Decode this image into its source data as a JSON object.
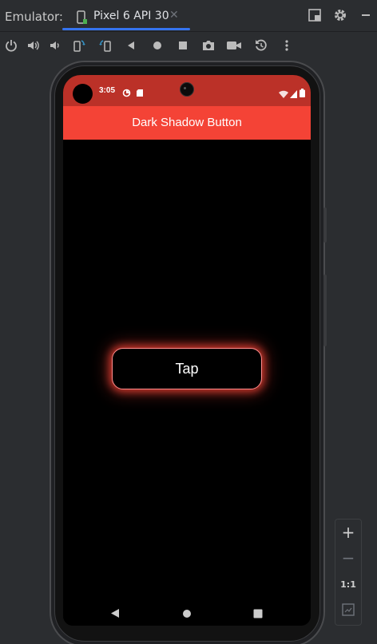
{
  "window": {
    "emulator_label": "Emulator:",
    "tab_label": "Pixel 6 API 30",
    "tab_close": "✕"
  },
  "toolbar": {
    "icons": [
      "power-icon",
      "volume-up-icon",
      "volume-down-icon",
      "rotate-left-icon",
      "rotate-right-icon",
      "back-icon",
      "home-icon",
      "overview-icon",
      "screenshot-icon",
      "screen-record-icon",
      "snapshot-icon",
      "more-icon"
    ]
  },
  "device": {
    "status_bar": {
      "time": "3:05",
      "color": "#bb3128"
    },
    "app_bar": {
      "title": "Dark Shadow Button",
      "color": "#f44336"
    },
    "button": {
      "label": "Tap",
      "glow_color": "#f44336"
    }
  },
  "zoom": {
    "zoom_in": "+",
    "zoom_out": "−",
    "actual_size": "1:1"
  }
}
